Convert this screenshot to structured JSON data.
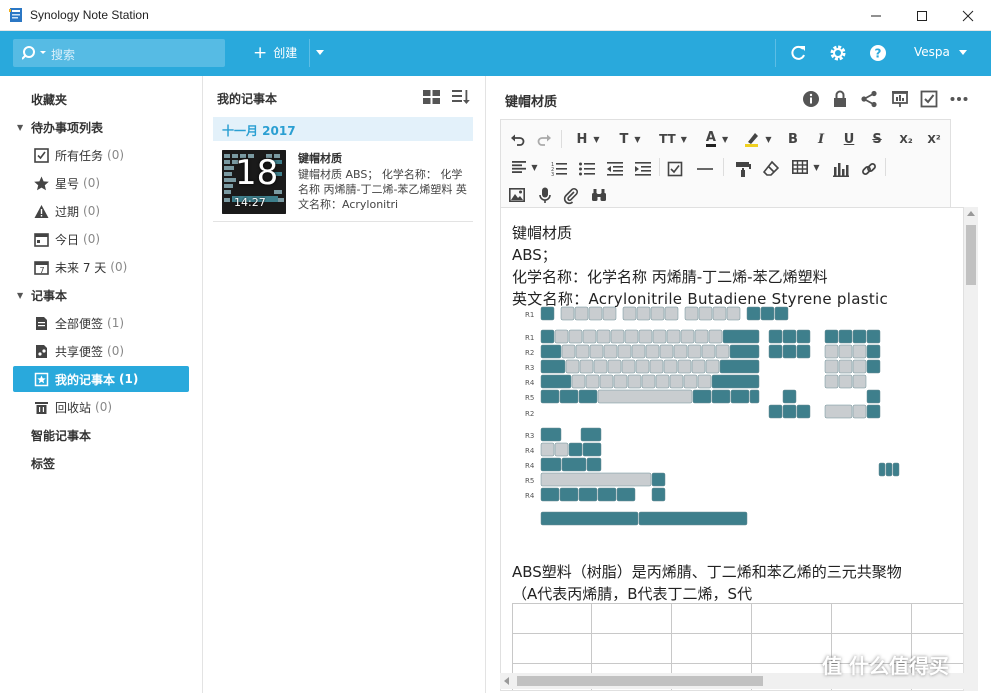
{
  "window": {
    "title": "Synology Note Station"
  },
  "toolbar": {
    "search_placeholder": "搜索",
    "create_label": "创建",
    "user": "Vespa"
  },
  "sidebar": {
    "favorites": "收藏夹",
    "todo_section": "待办事项列表",
    "todo_items": [
      {
        "label": "所有任务",
        "count": "(0)"
      },
      {
        "label": "星号",
        "count": "(0)"
      },
      {
        "label": "过期",
        "count": "(0)"
      },
      {
        "label": "今日",
        "count": "(0)"
      },
      {
        "label": "未来 7 天",
        "count": "(0)"
      }
    ],
    "notebook_section": "记事本",
    "notebook_items": [
      {
        "label": "全部便签",
        "count": "(1)"
      },
      {
        "label": "共享便签",
        "count": "(0)"
      },
      {
        "label": "我的记事本",
        "count": "(1)"
      },
      {
        "label": "回收站",
        "count": "(0)"
      }
    ],
    "smart_notebook": "智能记事本",
    "tags": "标签"
  },
  "note_list": {
    "header": "我的记事本",
    "month": "十一月 2017",
    "notes": [
      {
        "title": "键帽材质",
        "snippet": "键帽材质 ABS； 化学名称： 化学名称 丙烯腈-丁二烯-苯乙烯塑料 英文名称：Acrylonitri",
        "thumb_day": "18",
        "thumb_time": "14:27"
      }
    ]
  },
  "editor": {
    "title": "键帽材质",
    "lines": [
      "键帽材质",
      "ABS；",
      "化学名称：化学名称 丙烯腈-丁二烯-苯乙烯塑料",
      "英文名称：Acrylonitrile Butadiene Styrene plastic"
    ],
    "kb_row_labels": [
      "R1",
      "R1",
      "R2",
      "R3",
      "R4",
      "R5",
      "R2",
      "R3",
      "R4",
      "R4",
      "R5",
      "R4"
    ],
    "para1": "ABS塑料（树脂）是丙烯腈、丁二烯和苯乙烯的三元共聚物",
    "para2": "（A代表丙烯腈，B代表丁二烯，S代"
  },
  "format_toolbar": {
    "h_label": "H",
    "t_label": "T",
    "tt_label": "TT",
    "a_label": "A",
    "bold": "B",
    "italic": "I",
    "underline": "U",
    "strike": "S",
    "sub": "X₂",
    "sup": "X²"
  },
  "watermark": "值 什么值得买",
  "colors": {
    "accent": "#29a9dc",
    "keycap_teal": "#3e7f8c",
    "keycap_gray": "#c9cdd0"
  }
}
